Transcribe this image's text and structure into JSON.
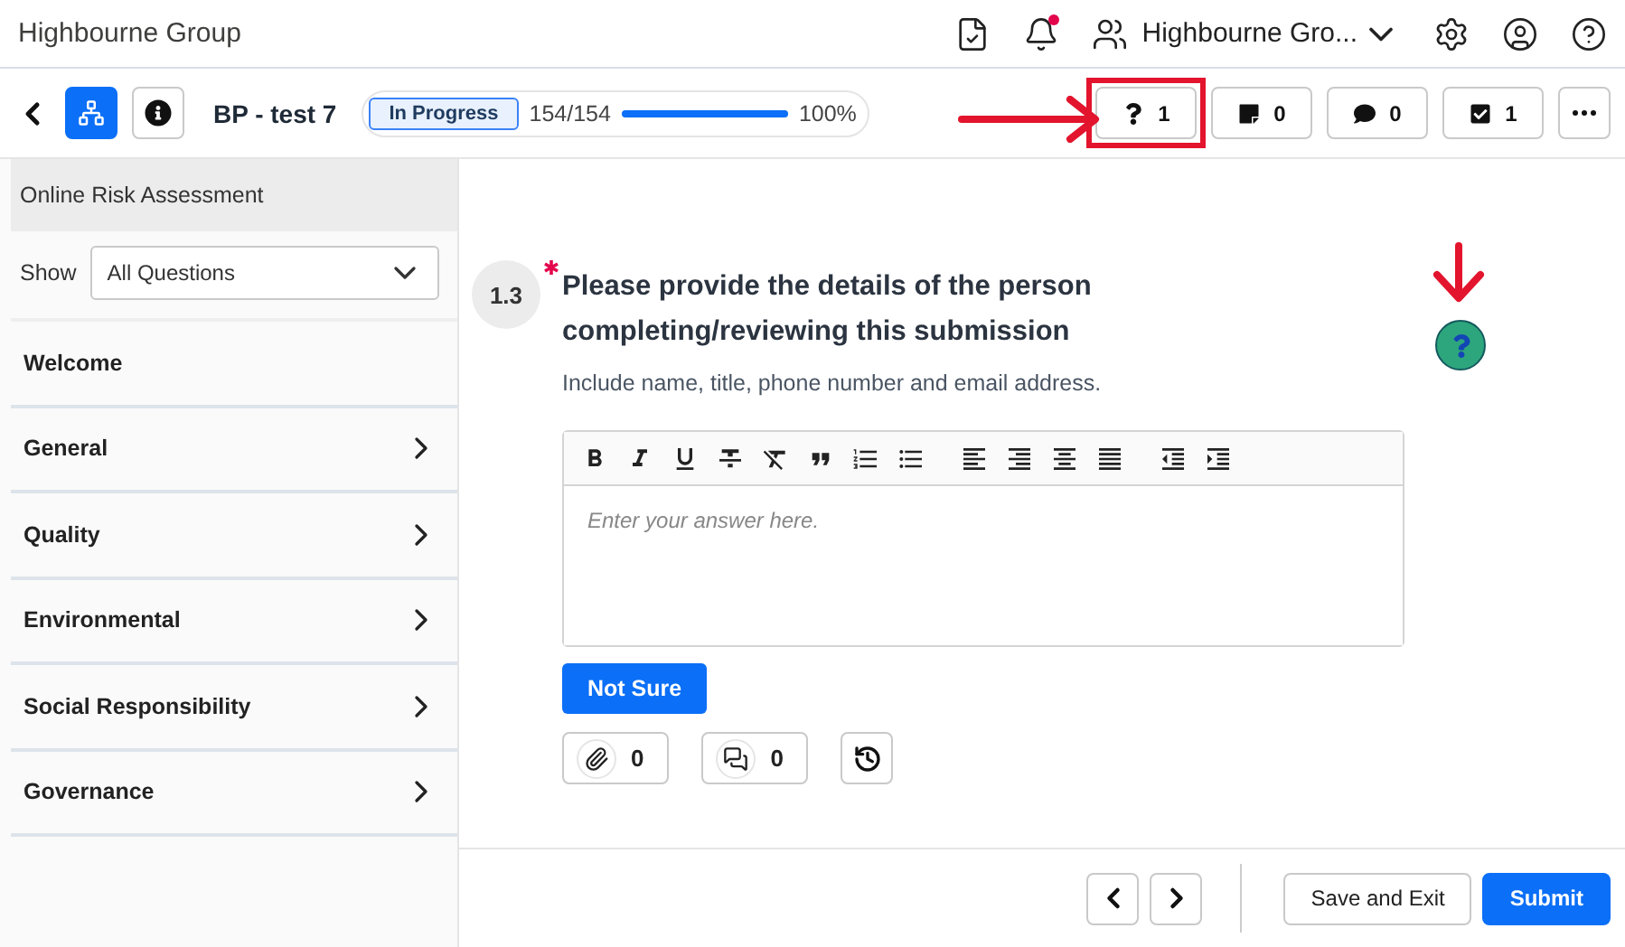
{
  "app": {
    "title": "Highbourne Group",
    "account": "Highbourne Gro...",
    "notification_unread": true
  },
  "toolbar": {
    "title": "BP - test 7",
    "status": "In Progress",
    "progress_text": "154/154",
    "level": 1,
    "percent": "100%",
    "counters": [
      {
        "kind": "help",
        "count": "1",
        "highlighted": true
      },
      {
        "kind": "note",
        "count": "0",
        "highlighted": false
      },
      {
        "kind": "comment",
        "count": "0",
        "highlighted": false
      },
      {
        "kind": "task",
        "count": "1",
        "highlighted": false
      }
    ]
  },
  "sidebar": {
    "title": "Online Risk Assessment",
    "filter_label": "Show",
    "filter_value": "All Questions",
    "sections": [
      {
        "label": "Welcome",
        "has_children": false
      },
      {
        "label": "General",
        "has_children": true
      },
      {
        "label": "Quality",
        "has_children": true
      },
      {
        "label": "Environmental",
        "has_children": true
      },
      {
        "label": "Social Responsibility",
        "has_children": true
      },
      {
        "label": "Governance",
        "has_children": true
      }
    ]
  },
  "question": {
    "number": "1.3",
    "required": true,
    "text": "Please provide the details of the person completing/reviewing this submission",
    "hint": "Include name, title, phone number and email address.",
    "placeholder": "Enter your answer here.",
    "not_sure": "Not Sure",
    "attachments": "0",
    "comments": "0",
    "help_highlighted": true
  },
  "footer": {
    "buttons": [
      "Save and Exit",
      "Submit"
    ]
  }
}
